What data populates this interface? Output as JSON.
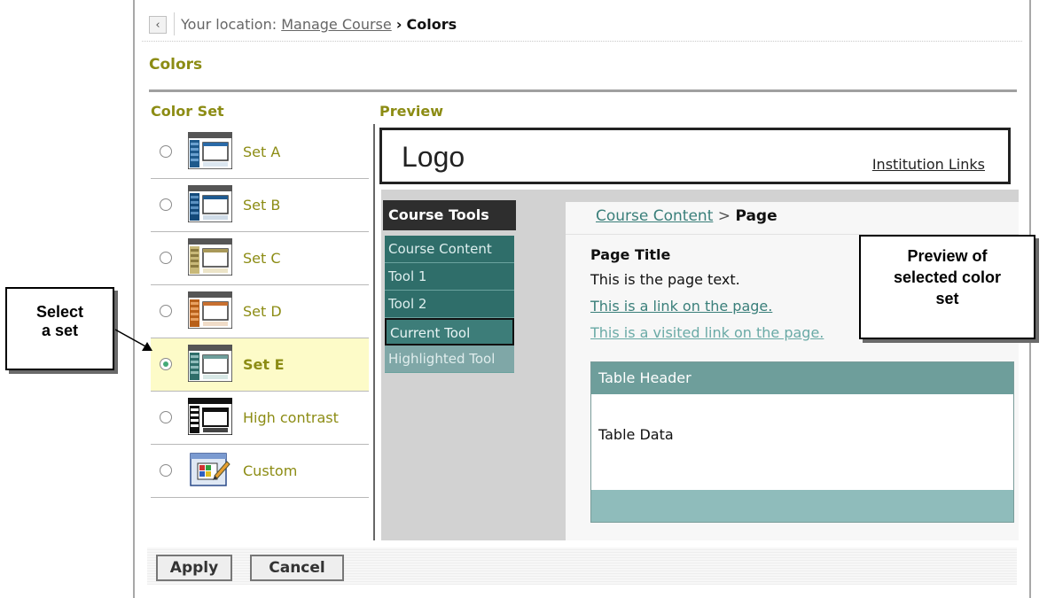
{
  "breadcrumb": {
    "back_glyph": "‹",
    "prefix": "Your location:",
    "parent_link": "Manage Course",
    "separator": "›",
    "current": "Colors"
  },
  "page_title": "Colors",
  "color_set": {
    "heading": "Color Set",
    "selected": "Set E",
    "options": [
      {
        "label": "Set A",
        "icon": "theme-thumbnail-icon"
      },
      {
        "label": "Set B",
        "icon": "theme-thumbnail-icon"
      },
      {
        "label": "Set C",
        "icon": "theme-thumbnail-icon"
      },
      {
        "label": "Set D",
        "icon": "theme-thumbnail-icon"
      },
      {
        "label": "Set E",
        "icon": "theme-thumbnail-icon"
      },
      {
        "label": "High contrast",
        "icon": "theme-thumbnail-icon"
      },
      {
        "label": "Custom",
        "icon": "palette-pencil-icon"
      }
    ]
  },
  "preview": {
    "heading": "Preview",
    "logo": "Logo",
    "institution_links": "Institution Links",
    "course_tools": "Course Tools",
    "menu": [
      "Course Content",
      "Tool 1",
      "Tool 2",
      "Current Tool",
      "Highlighted Tool"
    ],
    "content_breadcrumb_link": "Course Content",
    "content_breadcrumb_sep": ">",
    "content_breadcrumb_current": "Page",
    "page_title": "Page Title",
    "page_text": "This is the page text.",
    "link_text": "This is a link on the page.",
    "visited_link_text": "This is a visited link on the page.",
    "table_header": "Table Header",
    "table_data": "Table Data"
  },
  "buttons": {
    "apply": "Apply",
    "cancel": "Cancel"
  },
  "callouts": {
    "select": [
      "Select",
      "a set"
    ],
    "preview": [
      "Preview of",
      "selected color",
      "set"
    ]
  },
  "colors": {
    "heading_olive": "#8c8c14",
    "menu_teal": "#2f6e6a",
    "table_header": "#6e9e9b",
    "selected_row": "#fdfbc8"
  }
}
